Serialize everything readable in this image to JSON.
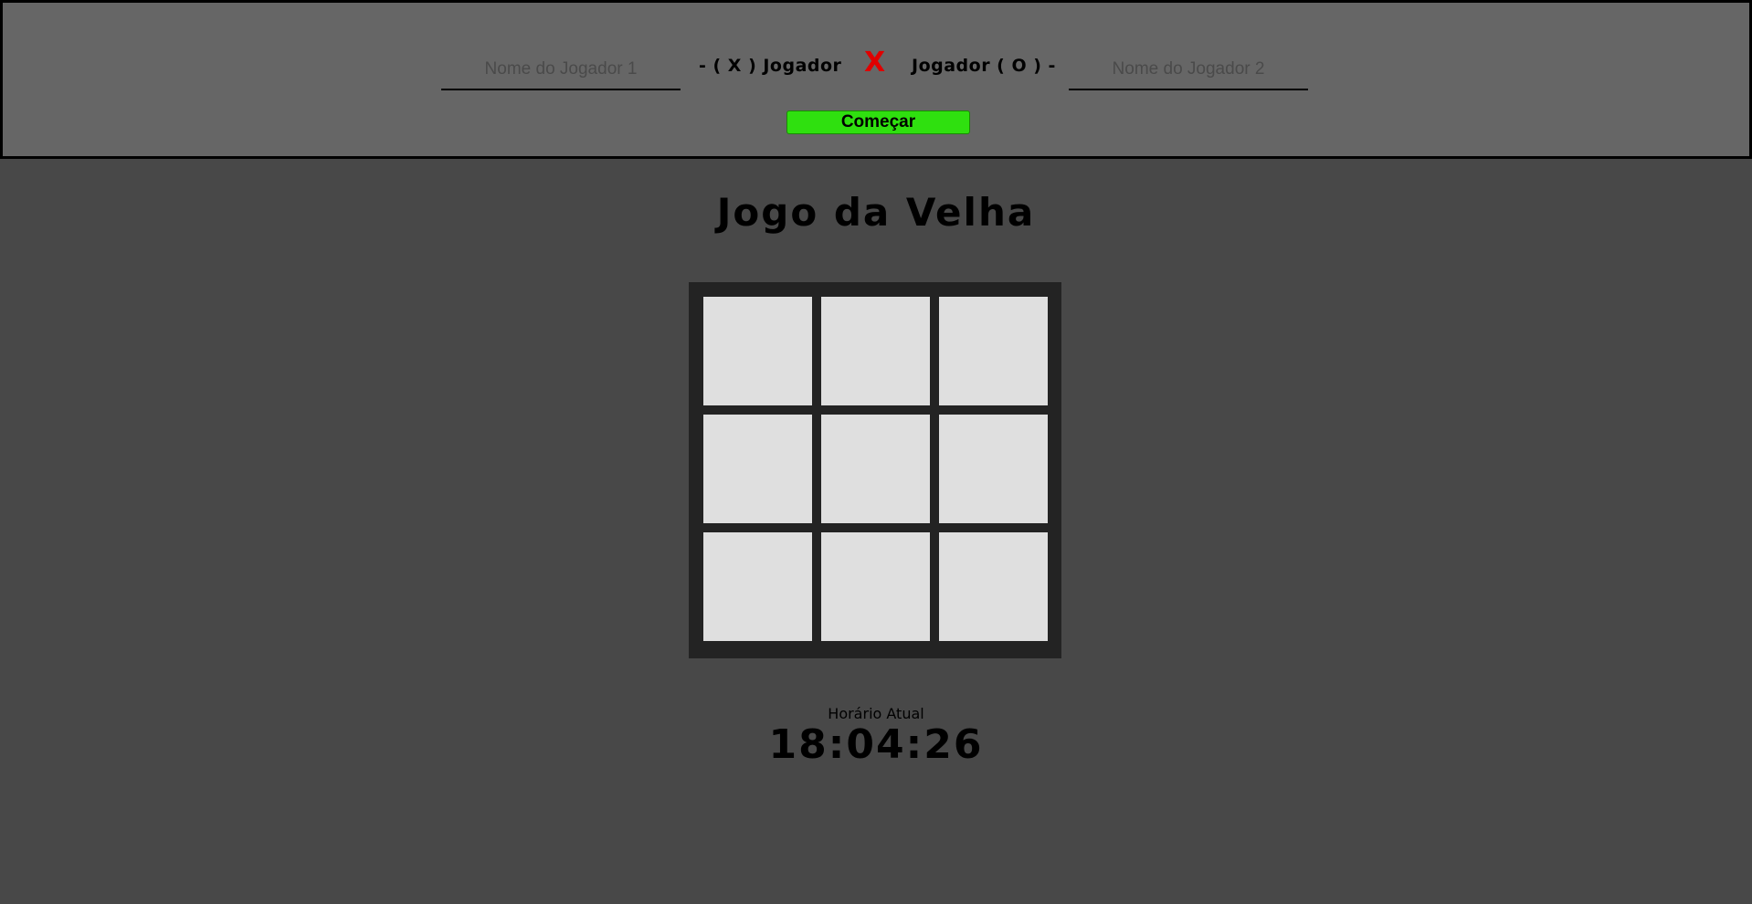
{
  "header": {
    "player1_placeholder": "Nome do Jogador 1",
    "player1_label": "- ( X ) Jogador",
    "vs_symbol": "X",
    "player2_label": "Jogador ( O ) -",
    "player2_placeholder": "Nome do Jogador 2",
    "start_button": "Começar"
  },
  "colors": {
    "header_bg": "#666666",
    "page_bg": "#484848",
    "board_bg": "#232323",
    "cell_bg": "#dfdfdf",
    "vs_color": "#e00000",
    "start_button_bg": "#2fe00f"
  },
  "game": {
    "title": "Jogo da Velha",
    "cells": [
      "",
      "",
      "",
      "",
      "",
      "",
      "",
      "",
      ""
    ]
  },
  "clock": {
    "label": "Horário Atual",
    "time": "18:04:26"
  }
}
